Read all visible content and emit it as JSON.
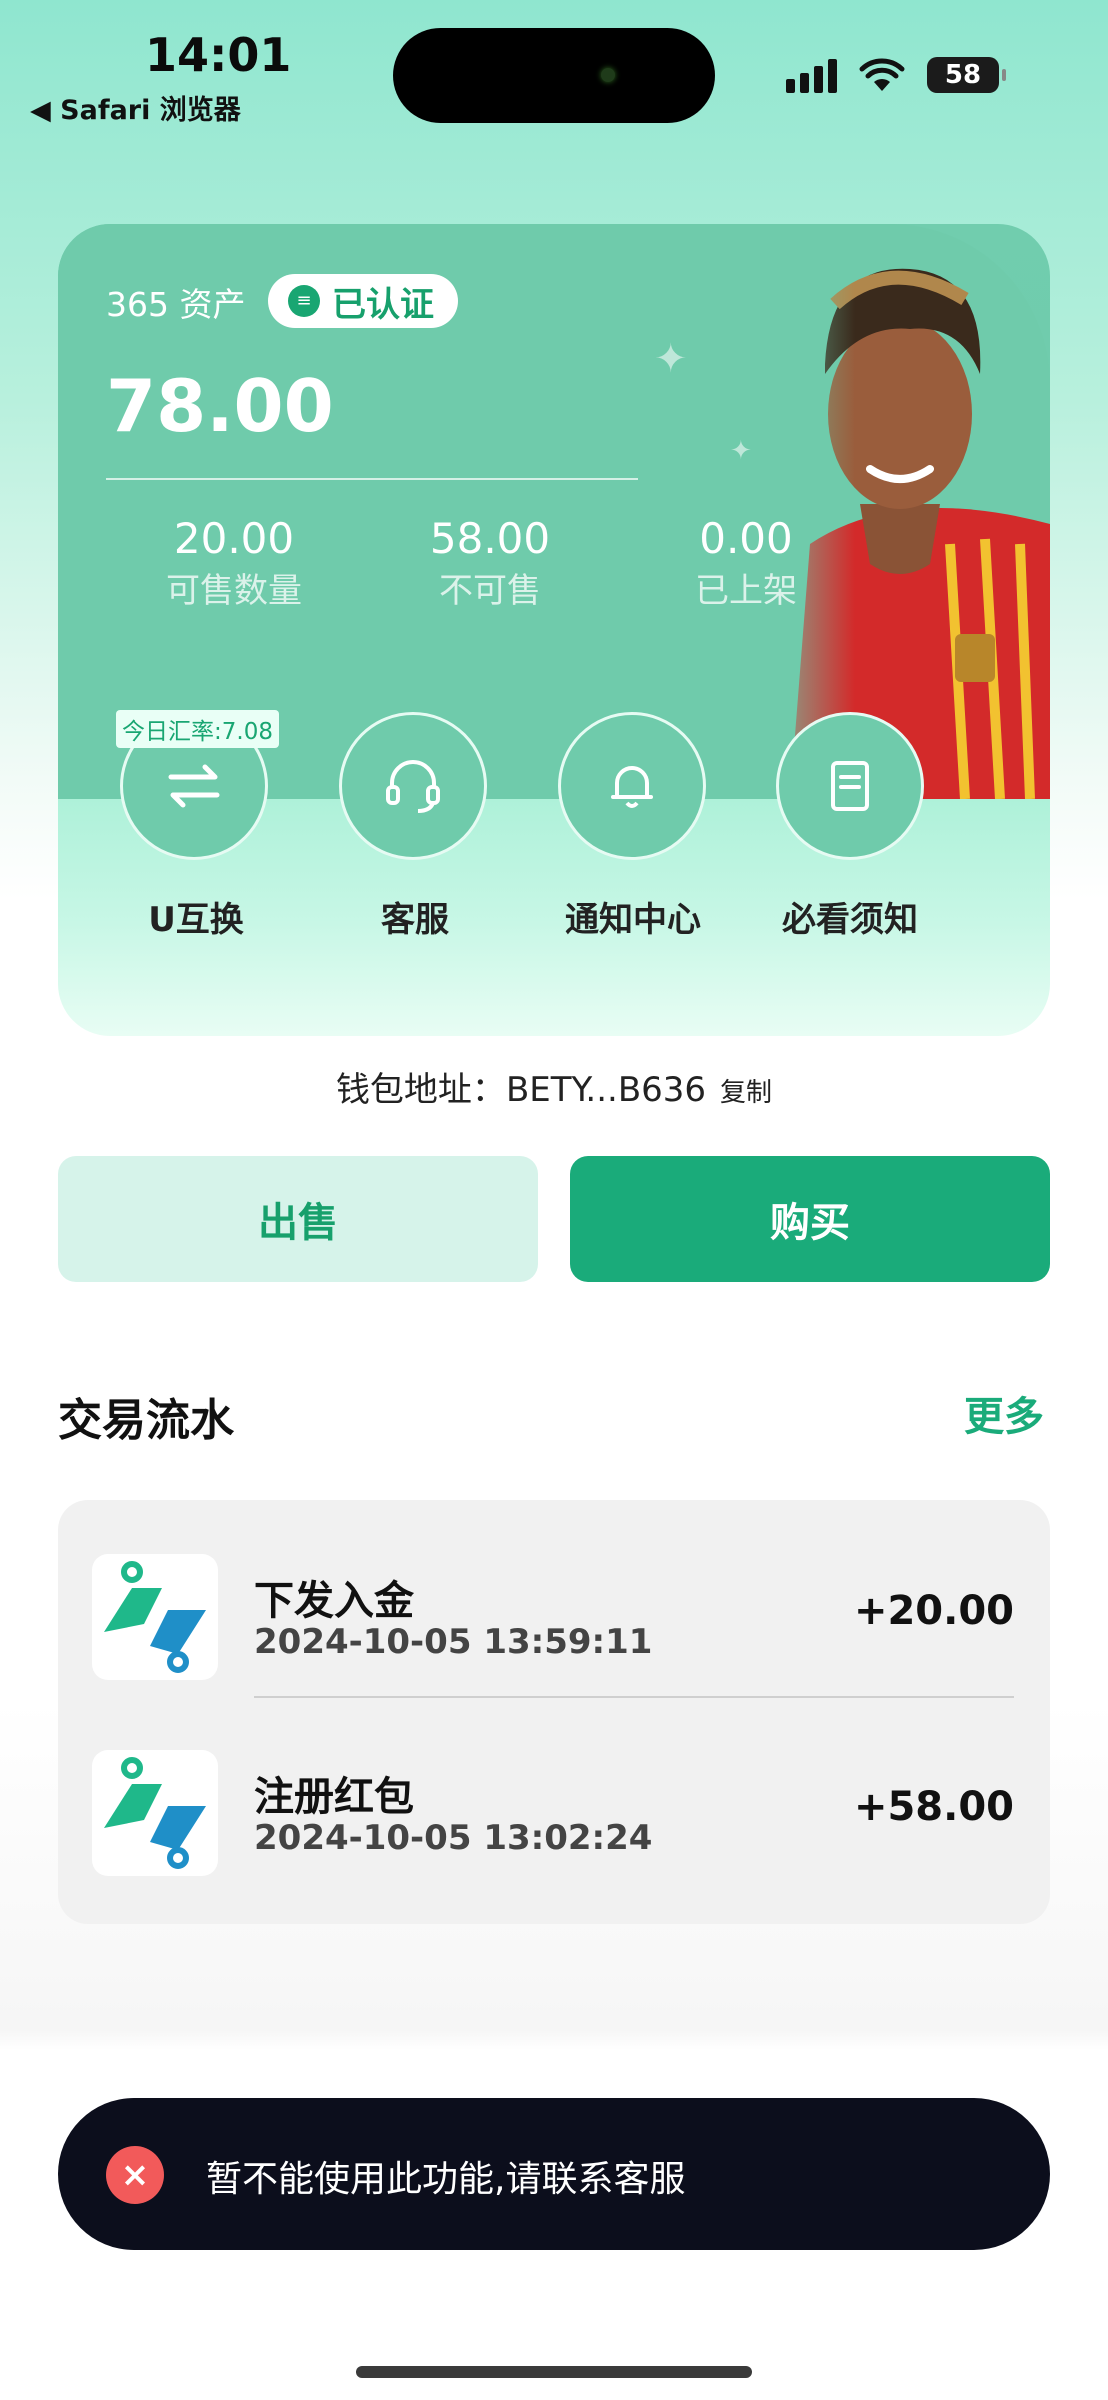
{
  "status_bar": {
    "time": "14:01",
    "back_label": "◀ Safari 浏览器",
    "battery": "58"
  },
  "card": {
    "asset_label": "365 资产",
    "verified_label": "已认证",
    "balance": "78.00",
    "stats": [
      {
        "value": "20.00",
        "label": "可售数量"
      },
      {
        "value": "58.00",
        "label": "不可售"
      },
      {
        "value": "0.00",
        "label": "已上架"
      }
    ],
    "rate_tag": "今日汇率:7.08",
    "actions": [
      {
        "label": "U互换",
        "icon": "swap-icon"
      },
      {
        "label": "客服",
        "icon": "headset-icon"
      },
      {
        "label": "通知中心",
        "icon": "bell-icon"
      },
      {
        "label": "必看须知",
        "icon": "document-icon"
      }
    ]
  },
  "wallet": {
    "label": "钱包地址：",
    "address": "BETY...B636",
    "copy_label": "复制"
  },
  "buttons": {
    "sell": "出售",
    "buy": "购买"
  },
  "transactions": {
    "title": "交易流水",
    "more": "更多",
    "items": [
      {
        "title": "下发入金",
        "time": "2024-10-05 13:59:11",
        "amount": "+20.00"
      },
      {
        "title": "注册红包",
        "time": "2024-10-05 13:02:24",
        "amount": "+58.00"
      }
    ]
  },
  "toast": {
    "message": "暂不能使用此功能,请联系客服"
  },
  "colors": {
    "accent": "#1aab7a",
    "card": "#6fcbab",
    "toast_bg": "#0c0e1c",
    "error": "#f25a5a"
  }
}
